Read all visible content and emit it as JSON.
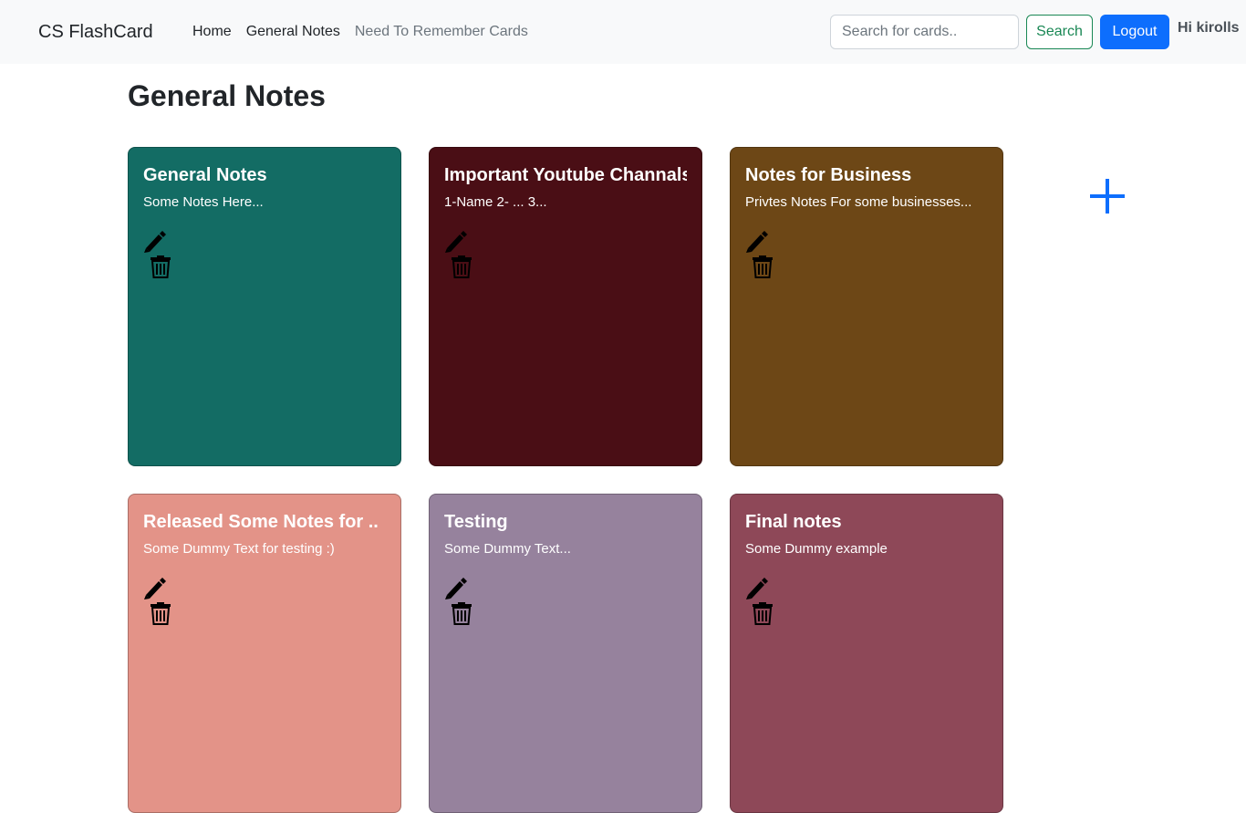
{
  "navbar": {
    "brand": "CS FlashCard",
    "links": [
      "Home",
      "General Notes",
      "Need To Remember Cards"
    ],
    "search_placeholder": "Search for cards..",
    "search_button": "Search",
    "logout_button": "Logout",
    "greeting": "Hi kirolls"
  },
  "page": {
    "title": "General Notes"
  },
  "add_button_icon": "plus-icon",
  "cards": [
    {
      "title": "General Notes",
      "text": "Some Notes Here...",
      "color": "#136c64"
    },
    {
      "title": "Important Youtube Channals",
      "text": "1-Name 2- ... 3...",
      "color": "#4a0e15"
    },
    {
      "title": "Notes for Business",
      "text": "Privtes Notes For some businesses...",
      "color": "#6d4716"
    },
    {
      "title": "Released Some Notes for ..",
      "text": "Some Dummy Text for testing :)",
      "color": "#e39388"
    },
    {
      "title": "Testing",
      "text": "Some Dummy Text...",
      "color": "#96829d"
    },
    {
      "title": "Final notes",
      "text": "Some Dummy example",
      "color": "#8e4858"
    }
  ],
  "card_icons": {
    "edit": "pen-icon",
    "delete": "trash-icon"
  },
  "colors": {
    "primary": "#0d6efd",
    "success": "#198754",
    "navbar_bg": "#f8f9fa"
  }
}
